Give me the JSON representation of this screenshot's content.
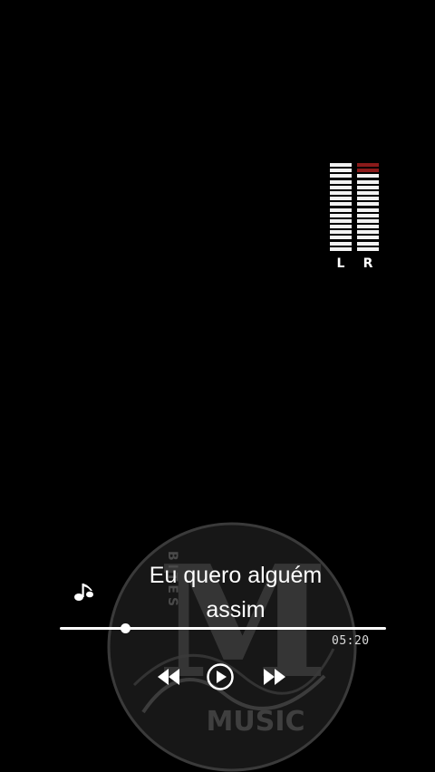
{
  "meter": {
    "left_label": "L",
    "right_label": "R",
    "segments": 16,
    "left_level_segments": 16,
    "right_peak_segments": 2,
    "peak_color": "#8b1a1a"
  },
  "watermark": {
    "brand_letter": "M",
    "brand_word": "MUSIC",
    "vertical_word": "BITES"
  },
  "lyrics": {
    "line1": "Eu quero alguém",
    "line2": "assim"
  },
  "player": {
    "progress_fraction": 0.2,
    "time_display": "05:20",
    "controls": {
      "rewind_icon": "rewind-icon",
      "play_icon": "play-icon",
      "forward_icon": "fast-forward-icon"
    }
  }
}
